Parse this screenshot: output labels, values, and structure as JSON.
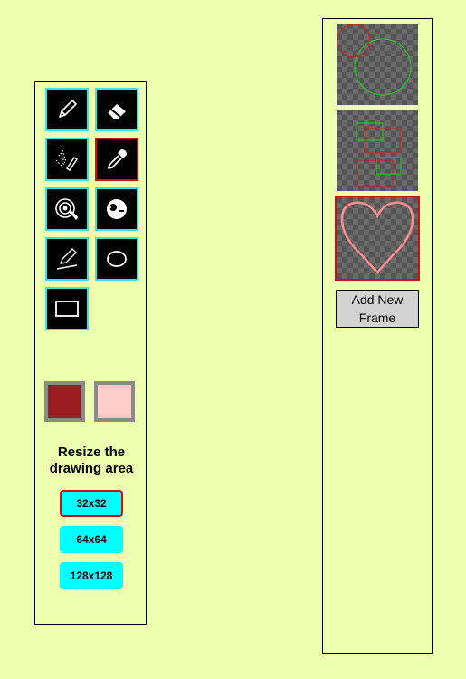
{
  "tools": [
    {
      "name": "pencil",
      "icon": "pencil-icon",
      "selected": false
    },
    {
      "name": "eraser",
      "icon": "eraser-icon",
      "selected": false
    },
    {
      "name": "spray",
      "icon": "spray-brush-icon",
      "selected": false
    },
    {
      "name": "eyedropper",
      "icon": "eyedropper-icon",
      "selected": true
    },
    {
      "name": "fill",
      "icon": "fill-target-icon",
      "selected": false
    },
    {
      "name": "lighten-darken",
      "icon": "lighten-darken-icon",
      "selected": false
    },
    {
      "name": "line",
      "icon": "line-icon",
      "selected": false
    },
    {
      "name": "ellipse",
      "icon": "ellipse-icon",
      "selected": false
    },
    {
      "name": "rectangle",
      "icon": "rectangle-icon",
      "selected": false
    }
  ],
  "colors": {
    "primary": "#9b1b1e",
    "secondary": "#ffcccc"
  },
  "resize": {
    "title_line1": "Resize the",
    "title_line2": "drawing area",
    "options": [
      "32x32",
      "64x64",
      "128x128"
    ],
    "selected": "32x32"
  },
  "frames": {
    "count": 3,
    "selected_index": 2,
    "add_label_line1": "Add New",
    "add_label_line2": "Frame"
  }
}
